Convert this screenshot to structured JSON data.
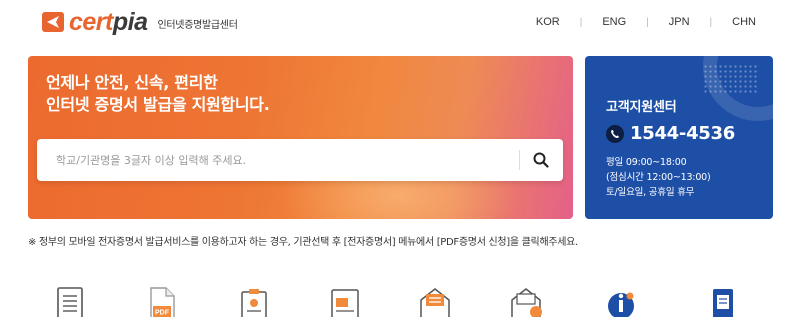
{
  "header": {
    "logo_cert": "cert",
    "logo_pia": "pia",
    "logo_subtitle": "인터넷증명발급센터",
    "languages": [
      "KOR",
      "ENG",
      "JPN",
      "CHN"
    ]
  },
  "hero": {
    "title_line1": "언제나 안전, 신속, 편리한",
    "title_line2": "인터넷 증명서 발급을 지원합니다.",
    "search_placeholder": "학교/기관명을 3글자 이상 입력해 주세요.",
    "search_icon": "search-icon"
  },
  "support": {
    "title": "고객지원센터",
    "phone": "1544-4536",
    "phone_icon": "phone-icon",
    "hours_line1": "평일 09:00~18:00",
    "hours_line2": "(점심시간 12:00~13:00)",
    "hours_line3": "토/일요일, 공휴일 휴무"
  },
  "notice": "※ 정부의 모바일 전자증명서 발급서비스를 이용하고자 하는 경우, 기관선택 후 [전자증명서] 메뉴에서 [PDF증명서 신청]을 클릭해주세요.",
  "icons": [
    "document-icon",
    "pdf-document-icon",
    "certificate-document-icon",
    "folder-document-icon",
    "mail-envelope-icon",
    "mail-search-icon",
    "info-person-icon",
    "mobile-document-icon"
  ],
  "colors": {
    "brand_orange": "#e9652f",
    "support_blue": "#1e4fa6"
  }
}
